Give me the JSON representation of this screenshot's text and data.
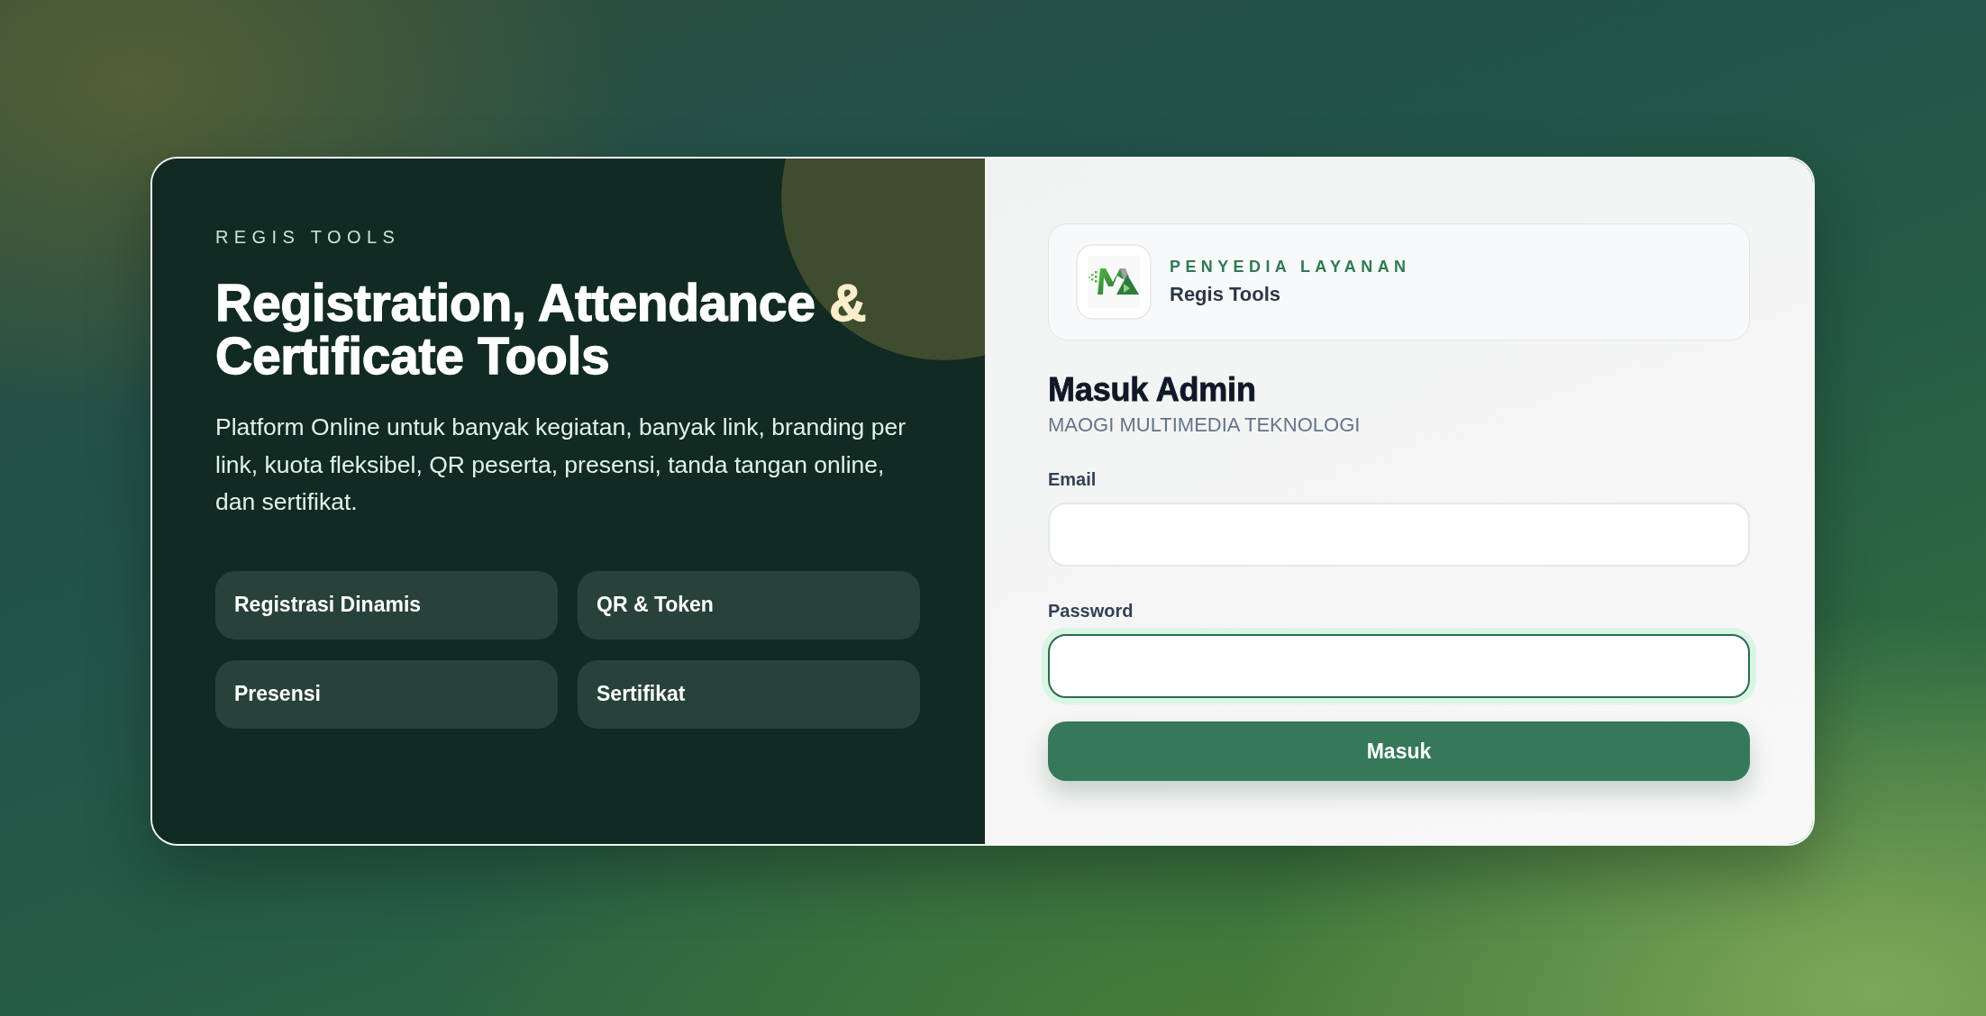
{
  "brand_panel": {
    "eyebrow": "REGIS TOOLS",
    "headline": [
      {
        "text": "Registration, Attendance ",
        "highlight": false
      },
      {
        "text": "&",
        "highlight": true
      },
      {
        "text": " Certificate Tools",
        "highlight": false
      }
    ],
    "description": "Platform Online untuk banyak kegiatan, banyak link, branding per link, kuota fleksibel, QR peserta, presensi, tanda tangan online, dan sertifikat.",
    "features": [
      "Registrasi Dinamis",
      "QR & Token",
      "Presensi",
      "Sertifikat"
    ]
  },
  "login_panel": {
    "provider": {
      "label": "PENYEDIA LAYANAN",
      "name": "Regis Tools"
    },
    "title": "Masuk Admin",
    "subtitle": "MAOGI MULTIMEDIA TEKNOLOGI",
    "fields": [
      {
        "label": "Email",
        "focused": false
      },
      {
        "label": "Password",
        "focused": true
      }
    ],
    "submit": "Masuk"
  }
}
